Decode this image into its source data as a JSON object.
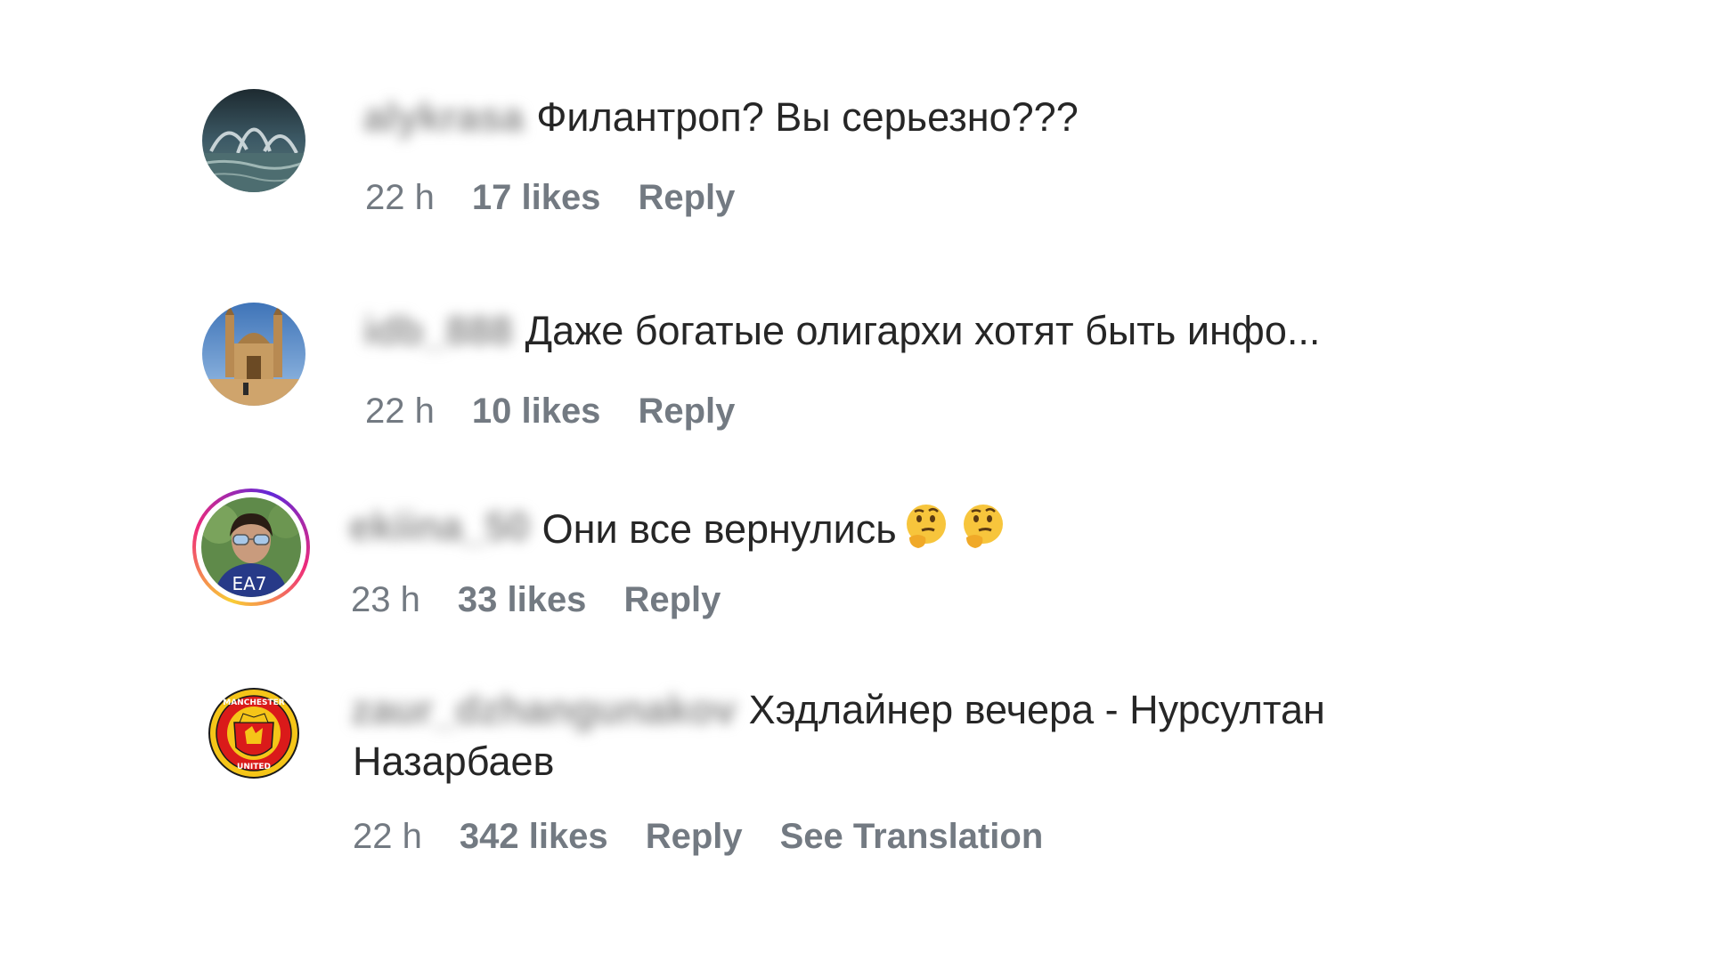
{
  "comments": [
    {
      "username": "alykrasa",
      "text": "Филантроп? Вы серьезно???",
      "time": "22 h",
      "likes": "17 likes",
      "reply": "Reply"
    },
    {
      "username": "idb_888",
      "text": "Даже богатые олигархи хотят быть инфо...",
      "time": "22 h",
      "likes": "10 likes",
      "reply": "Reply"
    },
    {
      "username": "ekiina_50",
      "text": "Они все вернулись",
      "emoji": [
        "thinking-face",
        "thinking-face"
      ],
      "time": "23 h",
      "likes": "33 likes",
      "reply": "Reply",
      "avatar_text": "EA7"
    },
    {
      "username": "zaur_dzhangunakov",
      "text_line1": "Хэдлайнер вечера - Нурсултан",
      "text_line2": "Назарбаев",
      "time": "22 h",
      "likes": "342 likes",
      "reply": "Reply",
      "translate": "See Translation",
      "avatar_text_top": "MANCHESTER",
      "avatar_text_bottom": "UNITED"
    }
  ],
  "colors": {
    "text": "#262626",
    "meta": "#737a82",
    "username_blur": "#8e8e8e"
  }
}
